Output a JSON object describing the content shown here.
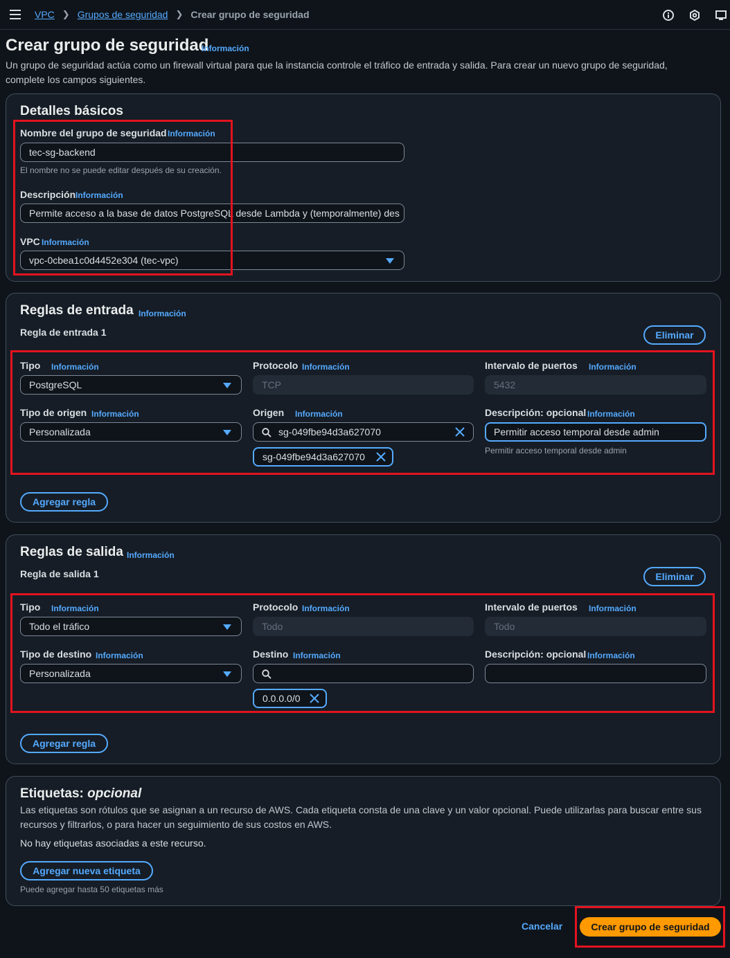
{
  "header": {
    "breadcrumb": [
      "VPC",
      "Grupos de seguridad",
      "Crear grupo de seguridad"
    ]
  },
  "page": {
    "title": "Crear grupo de seguridad",
    "info": "Información",
    "description": "Un grupo de seguridad actúa como un firewall virtual para que la instancia controle el tráfico de entrada y salida. Para crear un nuevo grupo de seguridad, complete los campos siguientes."
  },
  "basic": {
    "heading": "Detalles básicos",
    "name_label": "Nombre del grupo de seguridad",
    "name_value": "tec-sg-backend",
    "name_hint": "El nombre no se puede editar después de su creación.",
    "desc_label": "Descripción",
    "desc_value": "Permite acceso a la base de datos PostgreSQL desde Lambda y (temporalmente) des",
    "vpc_label": "VPC",
    "vpc_value": "vpc-0cbea1c0d4452e304 (tec-vpc)"
  },
  "inbound": {
    "heading": "Reglas de entrada",
    "rule_title": "Regla de entrada 1",
    "delete": "Eliminar",
    "type_label": "Tipo",
    "type_value": "PostgreSQL",
    "protocol_label": "Protocolo",
    "protocol_value": "TCP",
    "ports_label": "Intervalo de puertos",
    "ports_value": "5432",
    "source_type_label": "Tipo de origen",
    "source_type_value": "Personalizada",
    "source_label": "Origen",
    "source_value": "sg-049fbe94d3a627070",
    "source_token": "sg-049fbe94d3a627070",
    "desc_label": "Descripción: opcional",
    "desc_value": "Permitir acceso temporal desde admin",
    "desc_hint": "Permitir acceso temporal desde admin",
    "add_rule": "Agregar regla"
  },
  "outbound": {
    "heading": "Reglas de salida",
    "rule_title": "Regla de salida 1",
    "delete": "Eliminar",
    "type_label": "Tipo",
    "type_value": "Todo el tráfico",
    "protocol_label": "Protocolo",
    "protocol_value": "Todo",
    "ports_label": "Intervalo de puertos",
    "ports_value": "Todo",
    "dest_type_label": "Tipo de destino",
    "dest_type_value": "Personalizada",
    "dest_label": "Destino",
    "dest_token": "0.0.0.0/0",
    "desc_label": "Descripción: opcional",
    "add_rule": "Agregar regla"
  },
  "tags": {
    "heading": "Etiquetas:",
    "heading_optional": "opcional",
    "description": "Las etiquetas son rótulos que se asignan a un recurso de AWS. Cada etiqueta consta de una clave y un valor opcional. Puede utilizarlas para buscar entre sus recursos y filtrarlos, o para hacer un seguimiento de sus costos en AWS.",
    "none": "No hay etiquetas asociadas a este recurso.",
    "add_tag": "Agregar nueva etiqueta",
    "hint": "Puede agregar hasta 50 etiquetas más"
  },
  "footer": {
    "cancel": "Cancelar",
    "create": "Crear grupo de seguridad"
  },
  "icons": {
    "menu": "hamburger-menu-icon",
    "info": "info-circle-icon",
    "notifications": "notification-icon",
    "display": "display-settings-icon",
    "search": "search-icon",
    "dropdown": "caret-down-icon",
    "dismiss": "close-icon"
  },
  "colors": {
    "background": "#0f141a",
    "panel": "#161d26",
    "link": "#55aaff",
    "primary": "#ff9900",
    "highlight": "#e3131f"
  }
}
